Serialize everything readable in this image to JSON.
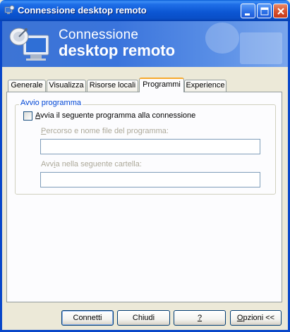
{
  "window": {
    "title": "Connessione desktop remoto"
  },
  "banner": {
    "line1": "Connessione",
    "line2": "desktop remoto"
  },
  "tabs": [
    {
      "label": "Generale",
      "active": false
    },
    {
      "label": "Visualizza",
      "active": false
    },
    {
      "label": "Risorse locali",
      "active": false
    },
    {
      "label": "Programmi",
      "active": true
    },
    {
      "label": "Experience",
      "active": false
    }
  ],
  "programs": {
    "group_label": "Avvio programma",
    "checkbox_label_hotkey": "A",
    "checkbox_label_rest": "vvia il seguente programma alla connessione",
    "checkbox_checked": false,
    "path_label_hotkey": "P",
    "path_label_rest": "ercorso e nome file del programma:",
    "path_value": "",
    "folder_label_prefix": "Avv",
    "folder_label_hotkey": "i",
    "folder_label_rest": "a  nella seguente cartella:",
    "folder_value": ""
  },
  "buttons": {
    "connect": "Connetti",
    "close": "Chiudi",
    "help": "?",
    "options_hotkey": "O",
    "options_rest": "pzioni <<"
  }
}
